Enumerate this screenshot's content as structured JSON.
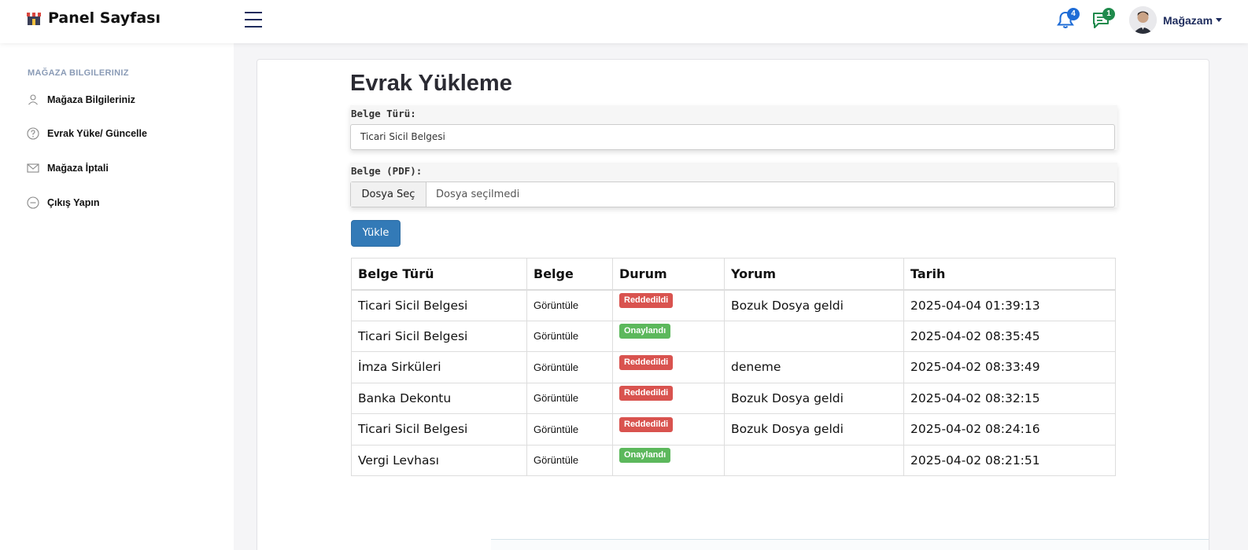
{
  "header": {
    "brand_title": "Panel Sayfası",
    "notifications_count": "4",
    "messages_count": "1",
    "user_name": "Mağazam"
  },
  "sidebar": {
    "heading": "MAĞAZA BILGILERINIZ",
    "items": [
      {
        "label": "Mağaza Bilgileriniz",
        "icon": "user-icon"
      },
      {
        "label": "Evrak Yüke/ Güncelle",
        "icon": "question-circle-icon"
      },
      {
        "label": "Mağaza İptali",
        "icon": "envelope-icon"
      },
      {
        "label": "Çıkış Yapın",
        "icon": "minus-circle-icon"
      }
    ]
  },
  "main": {
    "title": "Evrak Yükleme",
    "doc_type_label": "Belge Türü:",
    "doc_type_value": "Ticari Sicil Belgesi",
    "file_label": "Belge (PDF):",
    "file_button": "Dosya Seç",
    "file_status": "Dosya seçilmedi",
    "upload_button": "Yükle"
  },
  "table": {
    "headers": [
      "Belge Türü",
      "Belge",
      "Durum",
      "Yorum",
      "Tarih"
    ],
    "rows": [
      {
        "type": "Ticari Sicil Belgesi",
        "view": "Görüntüle",
        "status": "Reddedildi",
        "comment": "Bozuk Dosya geldi",
        "date": "2025-04-04 01:39:13"
      },
      {
        "type": "Ticari Sicil Belgesi",
        "view": "Görüntüle",
        "status": "Onaylandı",
        "comment": "",
        "date": "2025-04-02 08:35:45"
      },
      {
        "type": "İmza Sirküleri",
        "view": "Görüntüle",
        "status": "Reddedildi",
        "comment": "deneme",
        "date": "2025-04-02 08:33:49"
      },
      {
        "type": "Banka Dekontu",
        "view": "Görüntüle",
        "status": "Reddedildi",
        "comment": "Bozuk Dosya geldi",
        "date": "2025-04-02 08:32:15"
      },
      {
        "type": "Ticari Sicil Belgesi",
        "view": "Görüntüle",
        "status": "Reddedildi",
        "comment": "Bozuk Dosya geldi",
        "date": "2025-04-02 08:24:16"
      },
      {
        "type": "Vergi Levhası",
        "view": "Görüntüle",
        "status": "Onaylandı",
        "comment": "",
        "date": "2025-04-02 08:21:51"
      }
    ]
  },
  "colors": {
    "accent_navy": "#1d2b5c",
    "primary_button": "#337ab7",
    "status_rejected": "#d9534f",
    "status_approved": "#5cb85c"
  }
}
